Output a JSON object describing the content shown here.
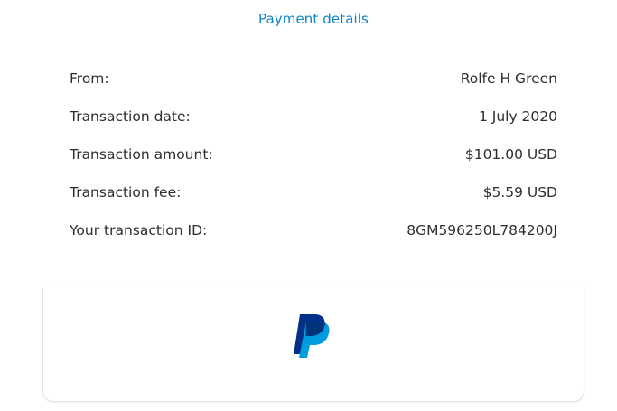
{
  "header": {
    "title": "Payment details"
  },
  "details": [
    {
      "label": "From:",
      "value": "Rolfe H Green"
    },
    {
      "label": "Transaction date:",
      "value": "1 July 2020"
    },
    {
      "label": "Transaction amount:",
      "value": "$101.00 USD"
    },
    {
      "label": "Transaction fee:",
      "value": "$5.59 USD"
    },
    {
      "label": "Your transaction ID:",
      "value": "8GM596250L784200J"
    }
  ],
  "footer": {
    "logo_icon": "paypal-logo-icon"
  },
  "colors": {
    "title": "#0e84c8",
    "text": "#2c2e2f",
    "paypal_dark": "#003087",
    "paypal_light": "#009cde"
  }
}
